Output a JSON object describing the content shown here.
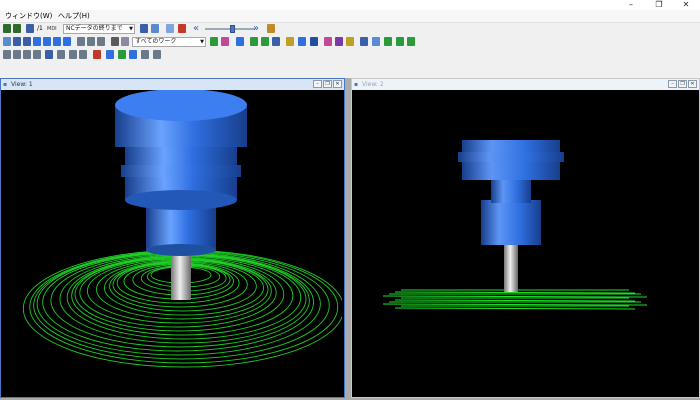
{
  "window": {
    "minimize_icon": "minimize-icon",
    "restore_icon": "restore-icon",
    "close_icon": "close-icon",
    "minimize_glyph": "–",
    "restore_glyph": "❐",
    "close_glyph": "✕"
  },
  "menu": {
    "items": [
      {
        "label": "ウィンドウ(W)"
      },
      {
        "label": "ヘルプ(H)"
      }
    ]
  },
  "toolbar": {
    "nc_combo_value": "NCデータの終りまで",
    "speed_label": "/1",
    "mdi_label": "MDI",
    "prev_glyph": "«",
    "next_glyph": "»",
    "speed_slider_fraction": 0.55,
    "work_combo_value": "すべてのワーク",
    "dropdown_glyph": "▼"
  },
  "views": [
    {
      "title": "View: 1",
      "state": "active"
    },
    {
      "title": "View: 2",
      "state": "inactive"
    }
  ],
  "colors": {
    "tool_body": "#2f6fe0",
    "tool_highlight": "#6aa3ff",
    "tool_shadow": "#173e8c",
    "toolpath": "#22e02a",
    "shank": "#c8c8c8",
    "viewport_bg": "#000000"
  }
}
